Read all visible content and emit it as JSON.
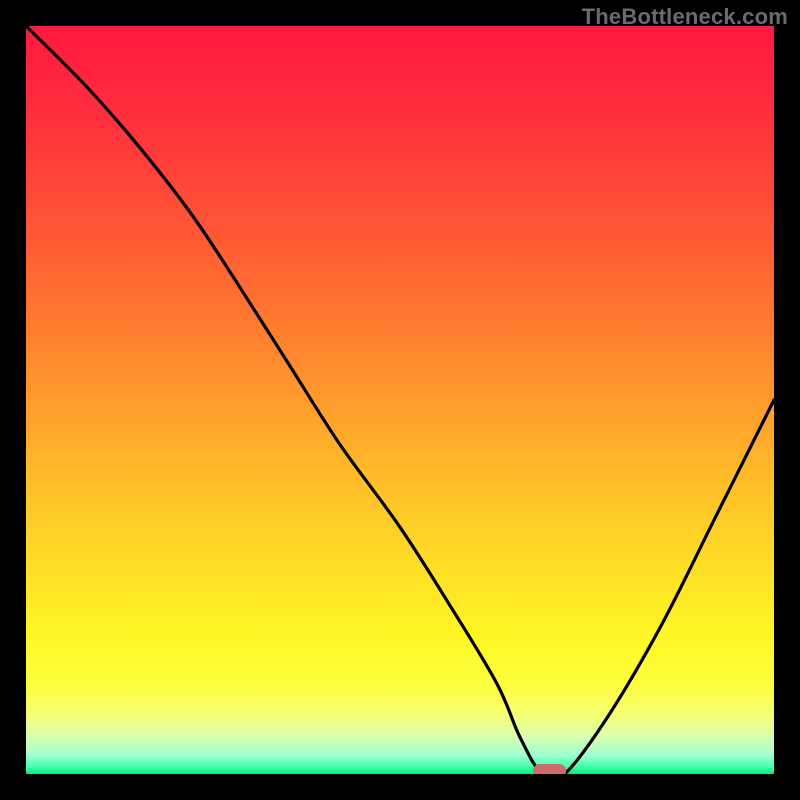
{
  "watermark": "TheBottleneck.com",
  "colors": {
    "frame": "#000000",
    "watermark": "#6b6b6b",
    "curve": "#000000",
    "marker": "#cd6a6e",
    "gradient_stops": [
      {
        "pos": 0.0,
        "color": "#ff183f"
      },
      {
        "pos": 0.12,
        "color": "#ff2f3d"
      },
      {
        "pos": 0.25,
        "color": "#ff5036"
      },
      {
        "pos": 0.38,
        "color": "#ff7530"
      },
      {
        "pos": 0.5,
        "color": "#ff9b2c"
      },
      {
        "pos": 0.62,
        "color": "#ffc128"
      },
      {
        "pos": 0.74,
        "color": "#ffe326"
      },
      {
        "pos": 0.82,
        "color": "#fff726"
      },
      {
        "pos": 0.88,
        "color": "#fdfe3e"
      },
      {
        "pos": 0.92,
        "color": "#f7ff72"
      },
      {
        "pos": 0.95,
        "color": "#d8ffb0"
      },
      {
        "pos": 0.975,
        "color": "#9effd2"
      },
      {
        "pos": 0.99,
        "color": "#44ffab"
      },
      {
        "pos": 1.0,
        "color": "#00e985"
      }
    ]
  },
  "chart_data": {
    "type": "line",
    "title": "",
    "xlabel": "",
    "ylabel": "",
    "xlim": [
      0,
      100
    ],
    "ylim": [
      0,
      100
    ],
    "series": [
      {
        "name": "bottleneck-curve",
        "x": [
          0,
          8,
          15,
          22,
          28,
          35,
          42,
          50,
          57,
          63,
          66,
          69,
          72,
          78,
          85,
          92,
          100
        ],
        "y": [
          100,
          92,
          84,
          75,
          66,
          55,
          44,
          33,
          22,
          12,
          5,
          0,
          0,
          8,
          20,
          34,
          50
        ]
      }
    ],
    "marker": {
      "x": 70,
      "y": 0,
      "width_frac": 0.045,
      "height_frac": 0.018
    }
  }
}
